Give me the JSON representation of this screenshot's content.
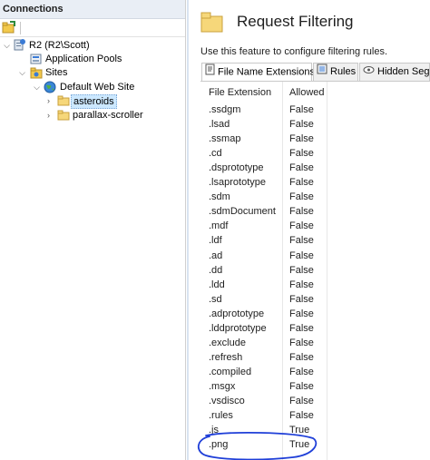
{
  "connections": {
    "header": "Connections",
    "tree": [
      {
        "label": "R2 (R2\\Scott)",
        "icon": "server-icon",
        "expanded": true
      },
      {
        "label": "Application Pools",
        "icon": "app-pools-icon"
      },
      {
        "label": "Sites",
        "icon": "sites-folder-icon",
        "expanded": true
      },
      {
        "label": "Default Web Site",
        "icon": "globe-icon",
        "expanded": true
      },
      {
        "label": "asteroids",
        "icon": "folder-icon",
        "selected": true
      },
      {
        "label": "parallax-scroller",
        "icon": "folder-icon"
      }
    ]
  },
  "feature": {
    "title": "Request Filtering",
    "description": "Use this feature to configure filtering rules."
  },
  "tabs": [
    {
      "label": "File Name Extensions",
      "icon": "document-icon",
      "active": true
    },
    {
      "label": "Rules",
      "icon": "rules-icon"
    },
    {
      "label": "Hidden Segm",
      "icon": "hidden-segments-icon"
    }
  ],
  "table": {
    "columns": [
      "File Extension",
      "Allowed"
    ],
    "rows": [
      [
        ".ssdgm",
        "False"
      ],
      [
        ".lsad",
        "False"
      ],
      [
        ".ssmap",
        "False"
      ],
      [
        ".cd",
        "False"
      ],
      [
        ".dsprototype",
        "False"
      ],
      [
        ".lsaprototype",
        "False"
      ],
      [
        ".sdm",
        "False"
      ],
      [
        ".sdmDocument",
        "False"
      ],
      [
        ".mdf",
        "False"
      ],
      [
        ".ldf",
        "False"
      ],
      [
        ".ad",
        "False"
      ],
      [
        ".dd",
        "False"
      ],
      [
        ".ldd",
        "False"
      ],
      [
        ".sd",
        "False"
      ],
      [
        ".adprototype",
        "False"
      ],
      [
        ".lddprototype",
        "False"
      ],
      [
        ".exclude",
        "False"
      ],
      [
        ".refresh",
        "False"
      ],
      [
        ".compiled",
        "False"
      ],
      [
        ".msgx",
        "False"
      ],
      [
        ".vsdisco",
        "False"
      ],
      [
        ".rules",
        "False"
      ],
      [
        ".js",
        "True"
      ],
      [
        ".png",
        "True"
      ]
    ]
  },
  "colors": {
    "header_bg": "#e9eef5",
    "selection": "#cce8ff",
    "annotation_circle": "#1f3fd8",
    "folder": "#f2c94c"
  }
}
